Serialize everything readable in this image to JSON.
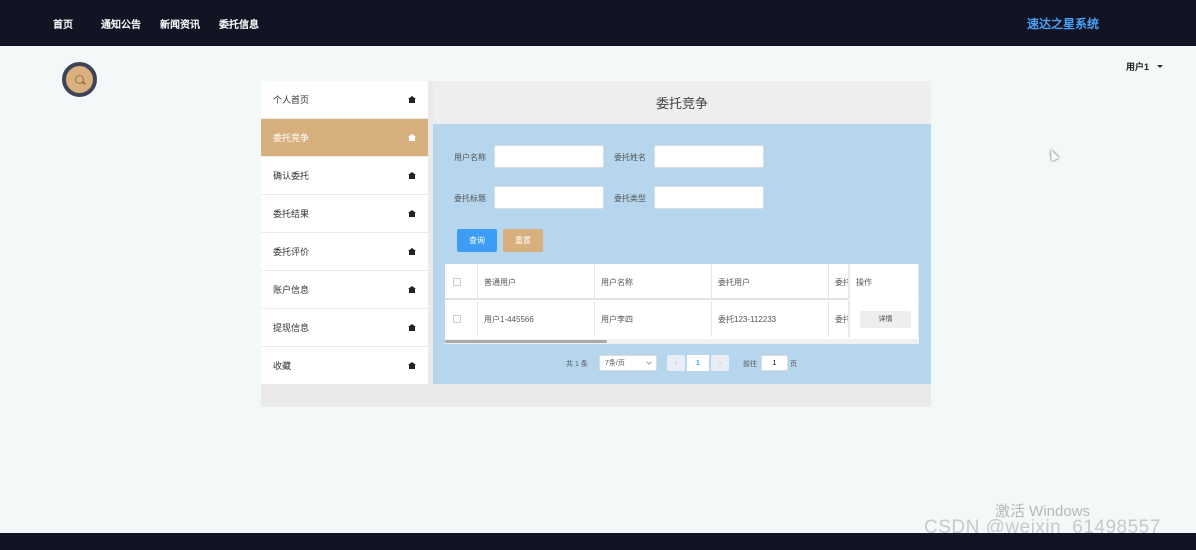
{
  "topbar": {
    "nav": [
      "首页",
      "通知公告",
      "新闻资讯",
      "委托信息"
    ],
    "brand": "速达之星系统"
  },
  "user_menu": {
    "label": "用户1"
  },
  "sidebar": {
    "items": [
      {
        "label": "个人首页",
        "active": false
      },
      {
        "label": "委托竞争",
        "active": true
      },
      {
        "label": "确认委托",
        "active": false
      },
      {
        "label": "委托结果",
        "active": false
      },
      {
        "label": "委托评价",
        "active": false
      },
      {
        "label": "账户信息",
        "active": false
      },
      {
        "label": "提现信息",
        "active": false
      },
      {
        "label": "收藏",
        "active": false
      }
    ]
  },
  "main": {
    "title": "委托竞争",
    "search": {
      "fields": [
        {
          "label": "用户名称",
          "value": "",
          "placeholder": ""
        },
        {
          "label": "委托姓名",
          "value": "",
          "placeholder": ""
        },
        {
          "label": "委托标题",
          "value": "",
          "placeholder": ""
        },
        {
          "label": "委托类型",
          "value": "",
          "placeholder": ""
        }
      ],
      "query_label": "查询",
      "reset_label": "重置"
    },
    "table": {
      "columns": [
        "普通用户",
        "用户名称",
        "委托用户",
        "委托",
        "操作"
      ],
      "rows": [
        {
          "cells": [
            "用户1-445566",
            "用户李四",
            "委托123-112233",
            "委托"
          ],
          "action": "详情"
        }
      ]
    },
    "pagination": {
      "total": "共 1 条",
      "page_size": "7条/页",
      "prev": "‹",
      "current_page": "1",
      "next": "›",
      "goto_label": "前往",
      "goto_value": "1",
      "page_suffix": "页"
    }
  },
  "watermark": {
    "activate": "激活 Windows",
    "csdn": "CSDN @weixin_61498557"
  },
  "colors": {
    "topbar": "#121424",
    "accent": "#d8b07e",
    "panel": "#b5d6ec",
    "primary": "#3d9df4"
  }
}
